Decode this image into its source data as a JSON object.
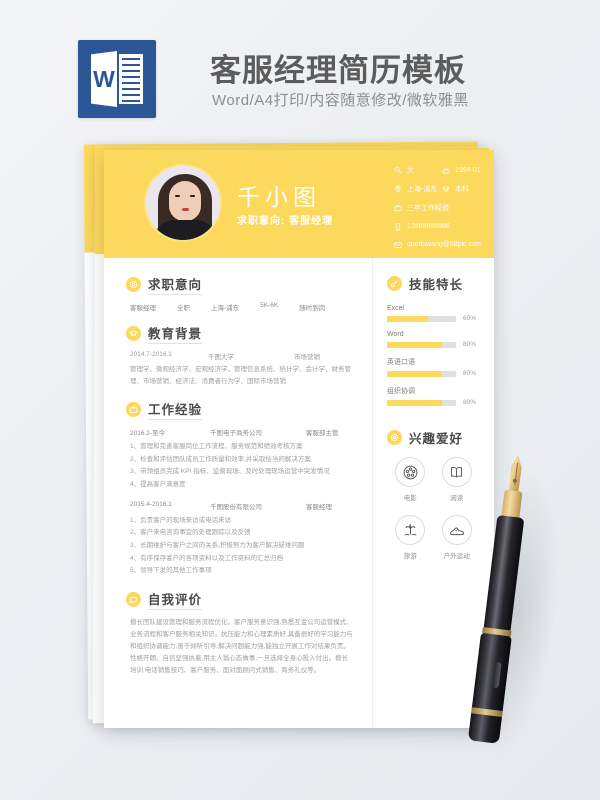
{
  "banner": {
    "title": "客服经理简历模板",
    "subtitle": "Word/A4打印/内容随意修改/微软雅黑",
    "icon": "word-icon",
    "word_letter": "W"
  },
  "colors": {
    "accent": "#FCD85C",
    "word_blue": "#2B5797",
    "background": "#ECEFF2",
    "text_dark": "#4A4A4A",
    "text_muted": "#A0A0A0"
  },
  "resume": {
    "header": {
      "name": "千小图",
      "objective_label": "求职意向:",
      "objective_value": "客服经理",
      "contacts": [
        {
          "icon": "gender-icon",
          "text": "女",
          "icon2": "birthday-icon",
          "text2": "1994-01"
        },
        {
          "icon": "location-icon",
          "text": "上海-浦东",
          "icon2": "education-cap-icon",
          "text2": "本科"
        },
        {
          "icon": "briefcase-icon",
          "text": "三年工作经验"
        },
        {
          "icon": "phone-icon",
          "text": "13888888888"
        },
        {
          "icon": "mail-icon",
          "text": "qiantuwang@58pic.com"
        }
      ]
    },
    "sections": {
      "objective": {
        "title": "求职意向",
        "icon": "target-icon",
        "items": [
          "客服经理",
          "全职",
          "上海-浦东",
          "5K-6K",
          "随时到岗"
        ]
      },
      "education": {
        "title": "教育背景",
        "icon": "graduation-cap-icon",
        "date": "2014.7-2016.1",
        "school": "千图大学",
        "major": "市场营销",
        "courses": "管理学、微观经济学、宏观经济学、管理信息系统、统计学、会计学、财务管理、市场营销、经济法、消费者行为学、国际市场营销"
      },
      "work": {
        "title": "工作经验",
        "icon": "briefcase-icon",
        "jobs": [
          {
            "date": "2016.2-至今",
            "company": "千图电子商务公司",
            "role": "客服部主管",
            "duties": [
              "1、管理和完善客服岗位工作流程、服务规范和绩效考核方案",
              "2、检查和评估团队成员工作质量和效率,并采取恰当的解决方案",
              "3、带领组员完成 KPI 指标、监督现场、及时处理现场运营中突发情况",
              "4、提高客户满意度"
            ]
          },
          {
            "date": "2015.4-2016.1",
            "company": "千图股份有限公司",
            "role": "客服经理",
            "duties": [
              "1、负责客户的现场来访或电话来访",
              "2、客户来电咨询事宜的处理跟踪以及反馈",
              "3、长期维护与客户之间的关系,积极努力为客户解决疑难问题",
              "4、有序保存客户的各项资料以及工作资料的汇总归档",
              "5、领导下发的其他工作事项"
            ]
          }
        ]
      },
      "self_evaluation": {
        "title": "自我评价",
        "icon": "chat-icon",
        "text": "擅长团队建设管理和服务流程优化。客户服务意识强,熟悉互金公司运营模式、业务流程和客户服务相关知识。抗压能力和心理素质好,具备很好的学习能力与和组织协调能力,善于倾听引导,解决问题能力强,能独立开展工作对结果负责。性格开朗、自信坚强执着,用主人翁心态做事,一旦选择全身心投入付出。擅长培训:电话销售技巧、客户服务、面对面顾问式销售、商务礼仪等。"
      },
      "skills": {
        "title": "技能特长",
        "icon": "key-icon",
        "items": [
          {
            "name": "Excel",
            "percent": "60%",
            "value": 60
          },
          {
            "name": "Word",
            "percent": "80%",
            "value": 80
          },
          {
            "name": "英语口语",
            "percent": "80%",
            "value": 80
          },
          {
            "name": "组织协调",
            "percent": "80%",
            "value": 80
          }
        ]
      },
      "hobbies": {
        "title": "兴趣爱好",
        "icon": "heart-circle-icon",
        "items": [
          {
            "label": "电影",
            "icon": "film-reel-icon"
          },
          {
            "label": "阅读",
            "icon": "book-icon"
          },
          {
            "label": "旅游",
            "icon": "palm-tree-icon"
          },
          {
            "label": "户外运动",
            "icon": "shoe-icon"
          }
        ]
      }
    }
  },
  "decor": {
    "pen": "fountain-pen"
  }
}
